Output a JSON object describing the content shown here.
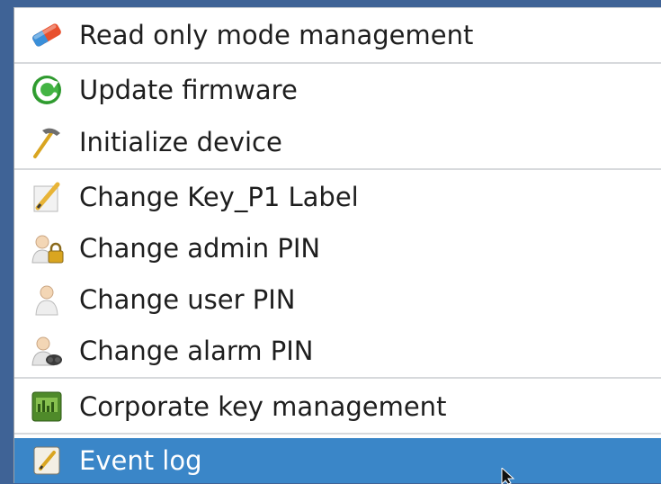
{
  "menu": {
    "items": [
      {
        "label": "Read only mode management",
        "icon": "eraser-icon"
      },
      {
        "label": "Update firmware",
        "icon": "refresh-icon"
      },
      {
        "label": "Initialize device",
        "icon": "hammer-icon"
      },
      {
        "label": "Change Key_P1 Label",
        "icon": "pencil-icon"
      },
      {
        "label": "Change admin PIN",
        "icon": "admin-lock-icon"
      },
      {
        "label": "Change user PIN",
        "icon": "user-icon"
      },
      {
        "label": "Change alarm PIN",
        "icon": "alarm-user-icon"
      },
      {
        "label": "Corporate key management",
        "icon": "corporate-key-icon"
      },
      {
        "label": "Event log",
        "icon": "event-log-icon",
        "selected": true
      }
    ]
  },
  "colors": {
    "selection": "#3a86c8",
    "background_edge": "#3f6396",
    "separator": "#d7d9dc"
  }
}
